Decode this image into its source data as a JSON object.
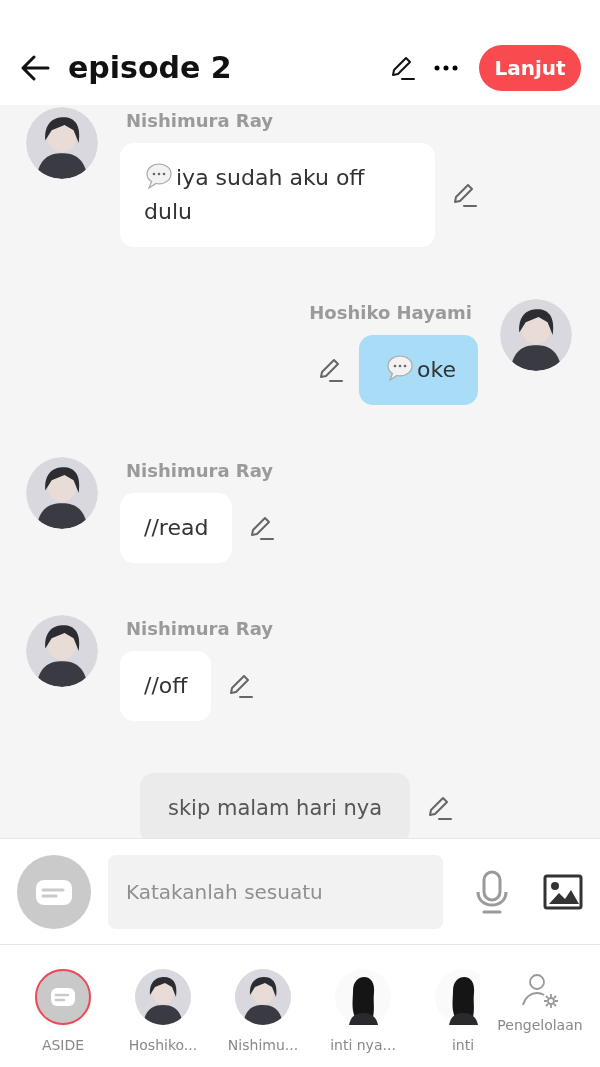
{
  "header": {
    "title": "episode 2",
    "next_button": "Lanjut"
  },
  "messages": [
    {
      "kind": "thought",
      "outgoing": false,
      "sender": "Nishimura Ray",
      "text": "iya sudah aku off dulu"
    },
    {
      "kind": "thought",
      "outgoing": true,
      "sender": "Hoshiko Hayami",
      "text": "oke"
    },
    {
      "kind": "text",
      "outgoing": false,
      "sender": "Nishimura Ray",
      "text": "//read"
    },
    {
      "kind": "text",
      "outgoing": false,
      "sender": "Nishimura Ray",
      "text": "//off"
    },
    {
      "kind": "aside",
      "text": "skip malam hari nya"
    }
  ],
  "composer": {
    "placeholder": "Katakanlah sesuatu"
  },
  "cast": [
    {
      "kind": "aside",
      "label": "ASIDE",
      "selected": true
    },
    {
      "kind": "character",
      "label": "Hoshiko...",
      "selected": false
    },
    {
      "kind": "character",
      "label": "Nishimu...",
      "selected": false
    },
    {
      "kind": "silhouette",
      "label": "inti nya...",
      "selected": false
    },
    {
      "kind": "silhouette",
      "label": "inti",
      "selected": false
    }
  ],
  "manage_button": "Pengelolaan"
}
